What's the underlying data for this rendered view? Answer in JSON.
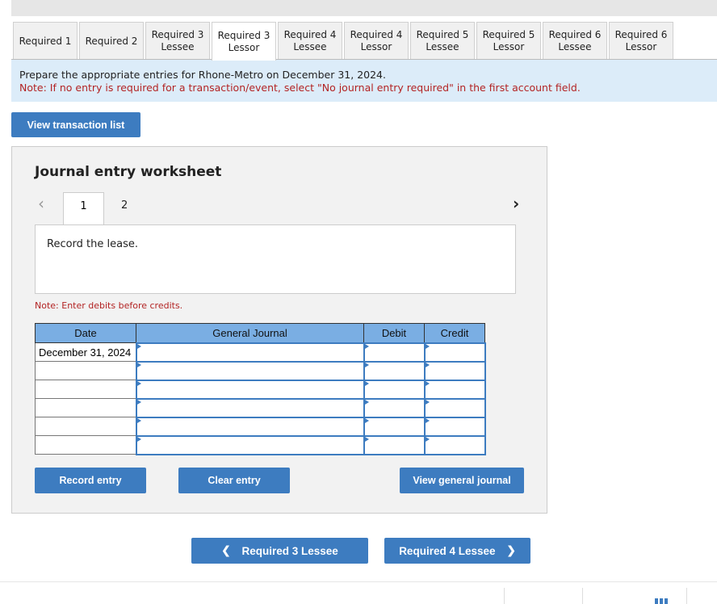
{
  "tabs": [
    {
      "l1": "Required 1",
      "l2": ""
    },
    {
      "l1": "Required 2",
      "l2": ""
    },
    {
      "l1": "Required 3",
      "l2": "Lessee"
    },
    {
      "l1": "Required 3",
      "l2": "Lessor"
    },
    {
      "l1": "Required 4",
      "l2": "Lessee"
    },
    {
      "l1": "Required 4",
      "l2": "Lessor"
    },
    {
      "l1": "Required 5",
      "l2": "Lessee"
    },
    {
      "l1": "Required 5",
      "l2": "Lessor"
    },
    {
      "l1": "Required 6",
      "l2": "Lessee"
    },
    {
      "l1": "Required 6",
      "l2": "Lessor"
    }
  ],
  "active_tab": 3,
  "instructions": "Prepare the appropriate entries for Rhone-Metro on December 31, 2024.",
  "note": "Note: If no entry is required for a transaction/event, select \"No journal entry required\" in the first account field.",
  "view_transactions": "View transaction list",
  "worksheet": {
    "title": "Journal entry worksheet",
    "pages": [
      "1",
      "2"
    ],
    "description": "Record the lease.",
    "debit_note": "Note: Enter debits before credits.",
    "columns": [
      "Date",
      "General Journal",
      "Debit",
      "Credit"
    ],
    "rows": [
      [
        "December 31, 2024",
        "",
        "",
        ""
      ],
      [
        "",
        "",
        "",
        ""
      ],
      [
        "",
        "",
        "",
        ""
      ],
      [
        "",
        "",
        "",
        ""
      ],
      [
        "",
        "",
        "",
        ""
      ],
      [
        "",
        "",
        "",
        ""
      ]
    ],
    "record": "Record entry",
    "clear": "Clear entry",
    "view_journal": "View general journal"
  },
  "nav": {
    "prev": "Required 3 Lessee",
    "next": "Required 4 Lessee"
  }
}
